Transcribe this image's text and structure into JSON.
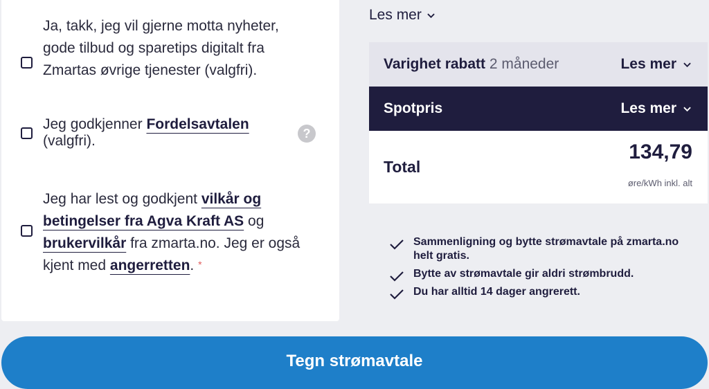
{
  "consents": [
    {
      "lines": [
        "Ja, takk, jeg vil gjerne motta nyheter,",
        "gode tilbud og sparetips digitalt fra",
        "Zmartas øvrige tjenester (valgfri)."
      ]
    },
    {
      "prefix": "Jeg godkjenner ",
      "link": "Fordelsavtalen",
      "suffix": "(valgfri)."
    },
    {
      "text1": "Jeg har lest og godkjent ",
      "link1": "vilkår og betingelser fra Agva Kraft AS",
      "text2": " og ",
      "link2": "brukervilkår",
      "text3": " fra zmarta.no. Jeg er også kjent med ",
      "link3": "angerretten",
      "text4": ".",
      "required": "*"
    }
  ],
  "help_icon": "?",
  "les_mer_top": "Les mer",
  "summary": {
    "varighet_label": "Varighet rabatt",
    "varighet_value": "2 måneder",
    "varighet_les_mer": "Les mer",
    "spot_label": "Spotpris",
    "spot_les_mer": "Les mer",
    "total_label": "Total",
    "total_value": "134,79",
    "total_unit": "øre/kWh inkl. alt"
  },
  "benefits": [
    "Sammenligning og bytte strømavtale på zmarta.no helt gratis.",
    "Bytte av strømavtale gir aldri strømbrudd.",
    "Du har alltid 14 dager angrerett."
  ],
  "cta_label": "Tegn strømavtale",
  "icons": {
    "chevron": "chevron-down-icon",
    "check": "check-icon",
    "help": "question-icon"
  },
  "colors": {
    "navy": "#1f1d3e",
    "cta": "#1e7fc9",
    "row_bg": "#e4e4ec",
    "background": "#edeef2"
  }
}
